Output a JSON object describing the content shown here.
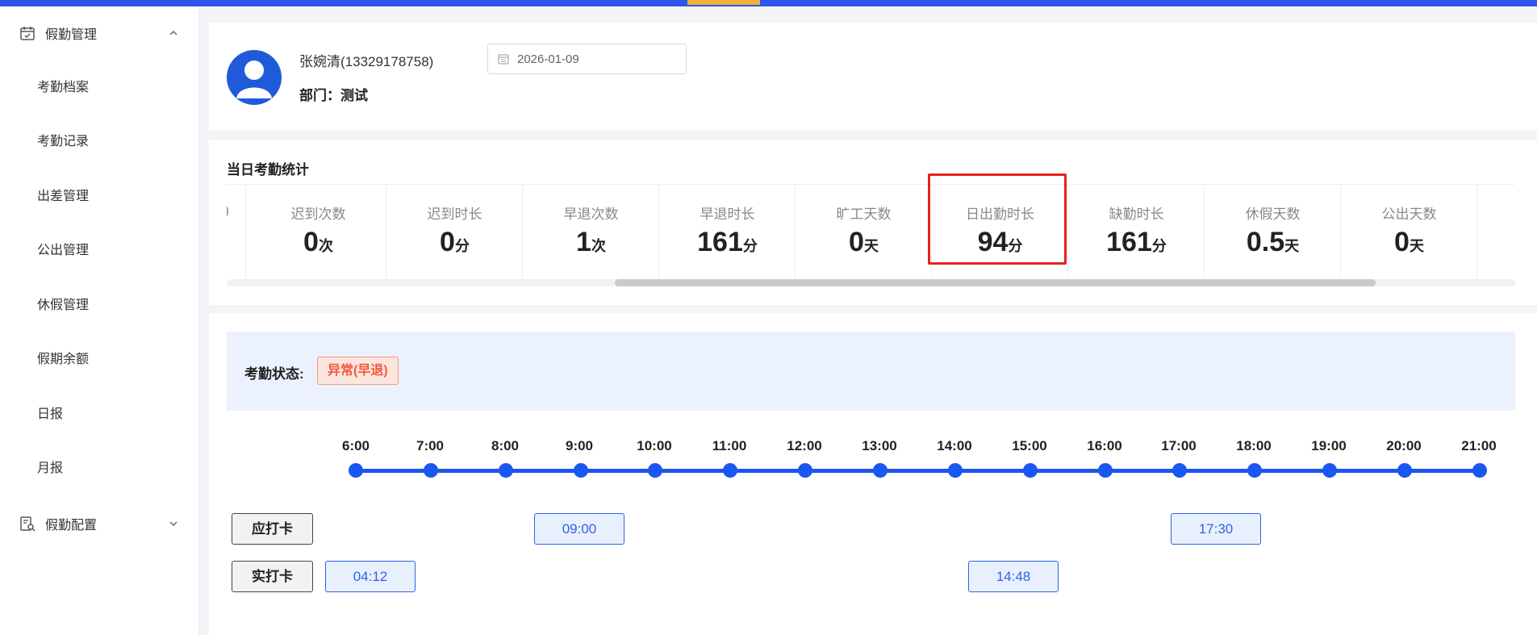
{
  "sidebar": {
    "group1": {
      "label": "假勤管理",
      "icon": "calendar-check-icon"
    },
    "items": [
      {
        "label": "考勤档案"
      },
      {
        "label": "考勤记录"
      },
      {
        "label": "出差管理"
      },
      {
        "label": "公出管理"
      },
      {
        "label": "休假管理"
      },
      {
        "label": "假期余额"
      },
      {
        "label": "日报"
      },
      {
        "label": "月报"
      }
    ],
    "group2": {
      "label": "假勤配置",
      "icon": "document-search-icon"
    }
  },
  "employee": {
    "name": "张婉清(13329178758)",
    "dept": "部门：测试",
    "date": "2026-01-09"
  },
  "stats": {
    "title": "当日考勤统计",
    "partial": ")",
    "items": [
      {
        "label": "迟到次数",
        "value": "0",
        "unit": "次"
      },
      {
        "label": "迟到时长",
        "value": "0",
        "unit": "分"
      },
      {
        "label": "早退次数",
        "value": "1",
        "unit": "次"
      },
      {
        "label": "早退时长",
        "value": "161",
        "unit": "分"
      },
      {
        "label": "旷工天数",
        "value": "0",
        "unit": "天"
      },
      {
        "label": "日出勤时长",
        "value": "94",
        "unit": "分"
      },
      {
        "label": "缺勤时长",
        "value": "161",
        "unit": "分"
      },
      {
        "label": "休假天数",
        "value": "0.5",
        "unit": "天"
      },
      {
        "label": "公出天数",
        "value": "0",
        "unit": "天"
      }
    ],
    "highlighted": "日出勤时长"
  },
  "status": {
    "label": "考勤状态:",
    "badge": "异常(早退)"
  },
  "timeline": {
    "hours": [
      "6:00",
      "7:00",
      "8:00",
      "9:00",
      "10:00",
      "11:00",
      "12:00",
      "13:00",
      "14:00",
      "15:00",
      "16:00",
      "17:00",
      "18:00",
      "19:00",
      "20:00",
      "21:00"
    ],
    "expected_label": "应打卡",
    "expected": [
      "09:00",
      "17:30"
    ],
    "actual_label": "实打卡",
    "actual": [
      "04:12",
      "14:48"
    ]
  },
  "colors": {
    "accent": "#1a56f0",
    "topbar": "#2f54eb",
    "error": "#e5231a",
    "badge": "#f15a3a"
  }
}
